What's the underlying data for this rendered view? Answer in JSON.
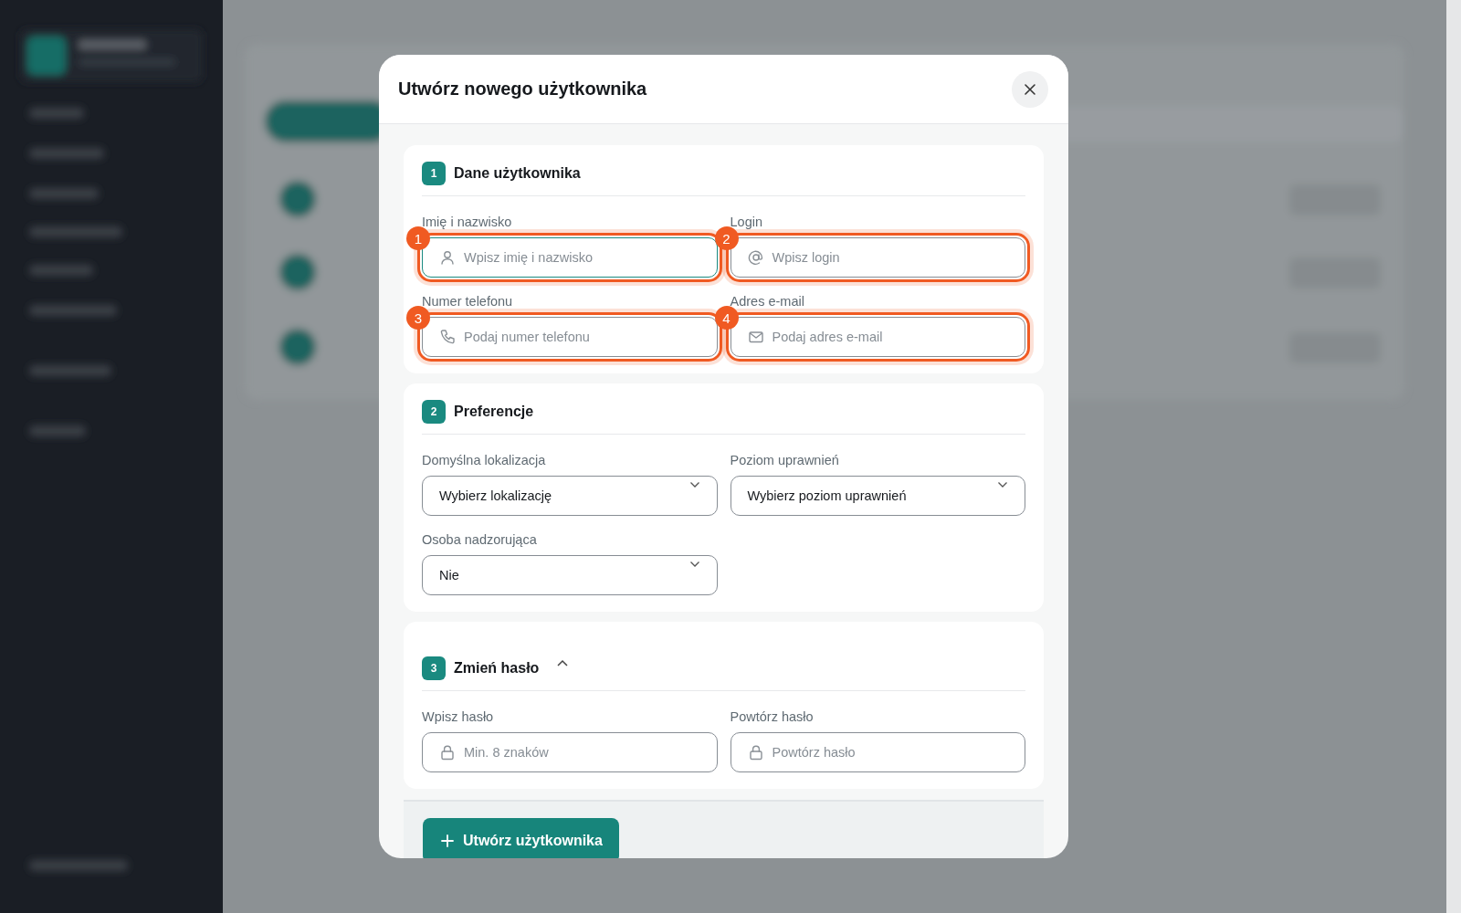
{
  "dialog": {
    "title": "Utwórz nowego użytkownika"
  },
  "sections": [
    {
      "number": "1",
      "title": "Dane użytkownika",
      "fields": [
        {
          "kind": "name",
          "label": "Imię i nazwisko",
          "placeholder": "Wpisz imię i nazwisko",
          "focused": true,
          "annotation": "1"
        },
        {
          "kind": "login",
          "label": "Login",
          "placeholder": "Wpisz login",
          "focused": false,
          "annotation": "2"
        },
        {
          "kind": "phone",
          "label": "Numer telefonu",
          "placeholder": "Podaj numer telefonu",
          "focused": false,
          "annotation": "3"
        },
        {
          "kind": "email",
          "label": "Adres e-mail",
          "placeholder": "Podaj adres e-mail",
          "focused": false,
          "annotation": "4"
        }
      ]
    },
    {
      "number": "2",
      "title": "Preferencje",
      "fields": [
        {
          "kind": "select",
          "label": "Domyślna lokalizacja",
          "value": "Wybierz lokalizację"
        },
        {
          "kind": "select",
          "label": "Poziom uprawnień",
          "value": "Wybierz poziom uprawnień"
        },
        {
          "kind": "select",
          "label": "Osoba nadzorująca",
          "value": "Nie"
        }
      ]
    },
    {
      "number": "3",
      "title": "Zmień hasło",
      "expanded": true,
      "fields": [
        {
          "kind": "password",
          "label": "Wpisz hasło",
          "placeholder": "Min. 8 znaków",
          "focused": false
        },
        {
          "kind": "password",
          "label": "Powtórz hasło",
          "placeholder": "Powtórz hasło",
          "focused": false
        }
      ]
    }
  ],
  "submit_button": {
    "label": "Utwórz użytkownika"
  }
}
